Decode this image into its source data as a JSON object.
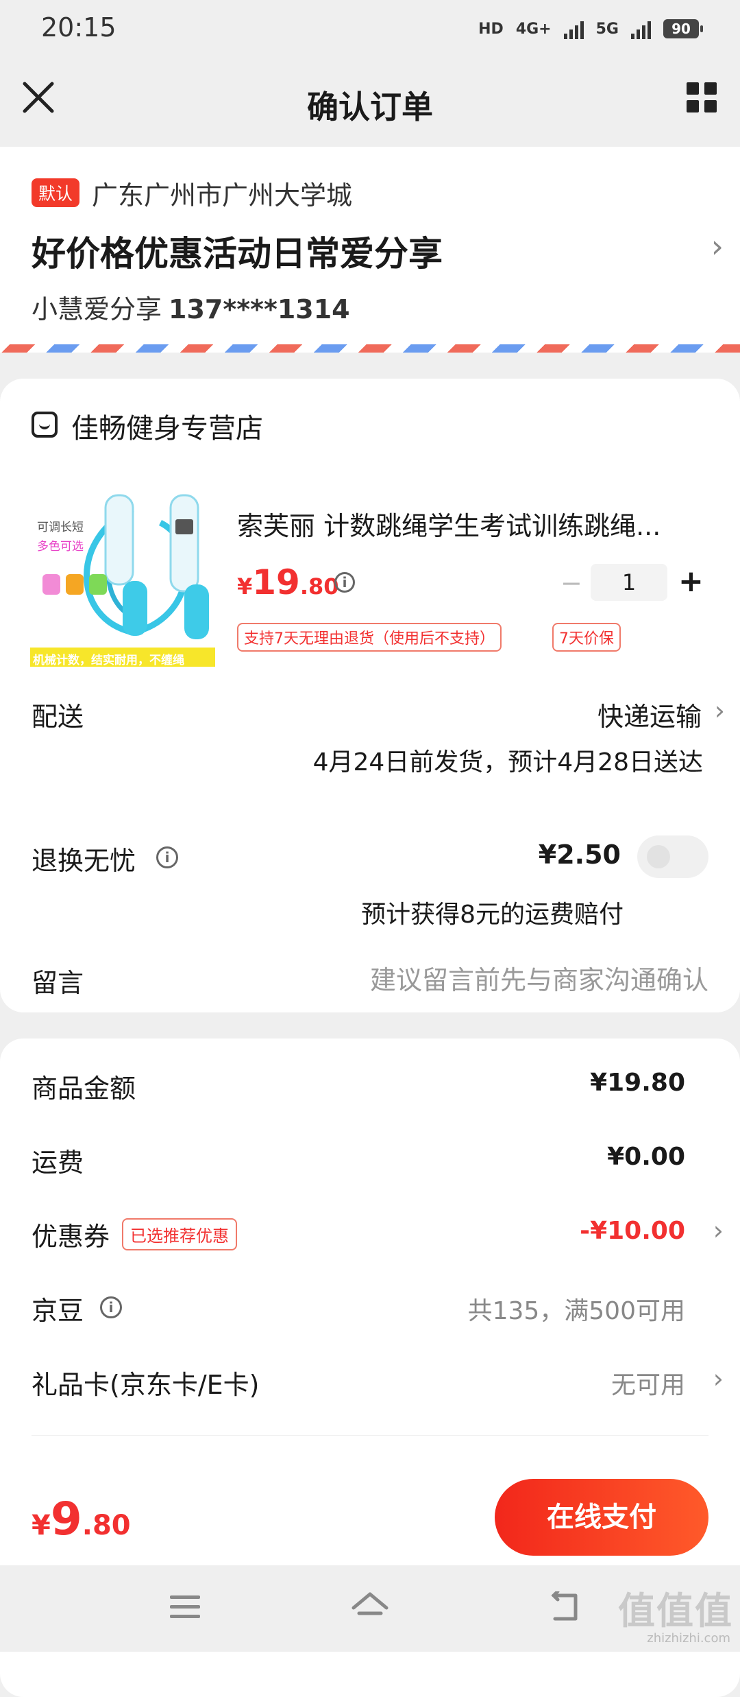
{
  "status_bar": {
    "time": "20:15",
    "hd": "HD",
    "net1": "4G+",
    "net2": "5G",
    "battery": "90"
  },
  "title_bar": {
    "title": "确认订单",
    "close_icon": "close-icon",
    "menu_icon": "grid-icon"
  },
  "address": {
    "default_tag": "默认",
    "region": "广东广州市广州大学城",
    "detail": "好价格优惠活动日常爱分享",
    "name": "小慧爱分享",
    "phone": "137****1314"
  },
  "store": {
    "name": "佳畅健身专营店"
  },
  "product": {
    "title": "索芙丽 计数跳绳学生考试训练跳绳...",
    "price_symbol": "¥",
    "price_int": "19",
    "price_dec": ".80",
    "quantity": "1",
    "minus": "−",
    "plus": "+",
    "tags": [
      "支持7天无理由退货（使用后不支持）",
      "7天价保"
    ],
    "image_texts": [
      "可调长短",
      "多色可选",
      "机械计数，结实耐用，不缠绳"
    ]
  },
  "delivery": {
    "label": "配送",
    "method": "快递运输",
    "date_note": "4月24日前发货，预计4月28日送达"
  },
  "exchange": {
    "label": "退换无忧",
    "price": "¥2.50",
    "note": "预计获得8元的运费赔付",
    "enabled": false
  },
  "message": {
    "label": "留言",
    "placeholder": "建议留言前先与商家沟通确认"
  },
  "summary": {
    "goods_label": "商品金额",
    "goods_value": "¥19.80",
    "shipping_label": "运费",
    "shipping_value": "¥0.00",
    "coupon_label": "优惠券",
    "coupon_tag": "已选推荐优惠",
    "coupon_value": "-¥10.00",
    "beans_label": "京豆",
    "beans_value": "共135，满500可用",
    "giftcard_label": "礼品卡(京东卡/E卡)",
    "giftcard_value": "无可用"
  },
  "pay_bar": {
    "symbol": "¥",
    "total_int": "9",
    "total_dec": ".80",
    "button": "在线支付"
  },
  "watermark": {
    "main": "值值值",
    "sub": "zhizhizhi.com"
  },
  "colors": {
    "accent": "#f23030",
    "pay_gradient_start": "#f2271b",
    "pay_gradient_end": "#ff5a2a",
    "background": "#efefef"
  }
}
